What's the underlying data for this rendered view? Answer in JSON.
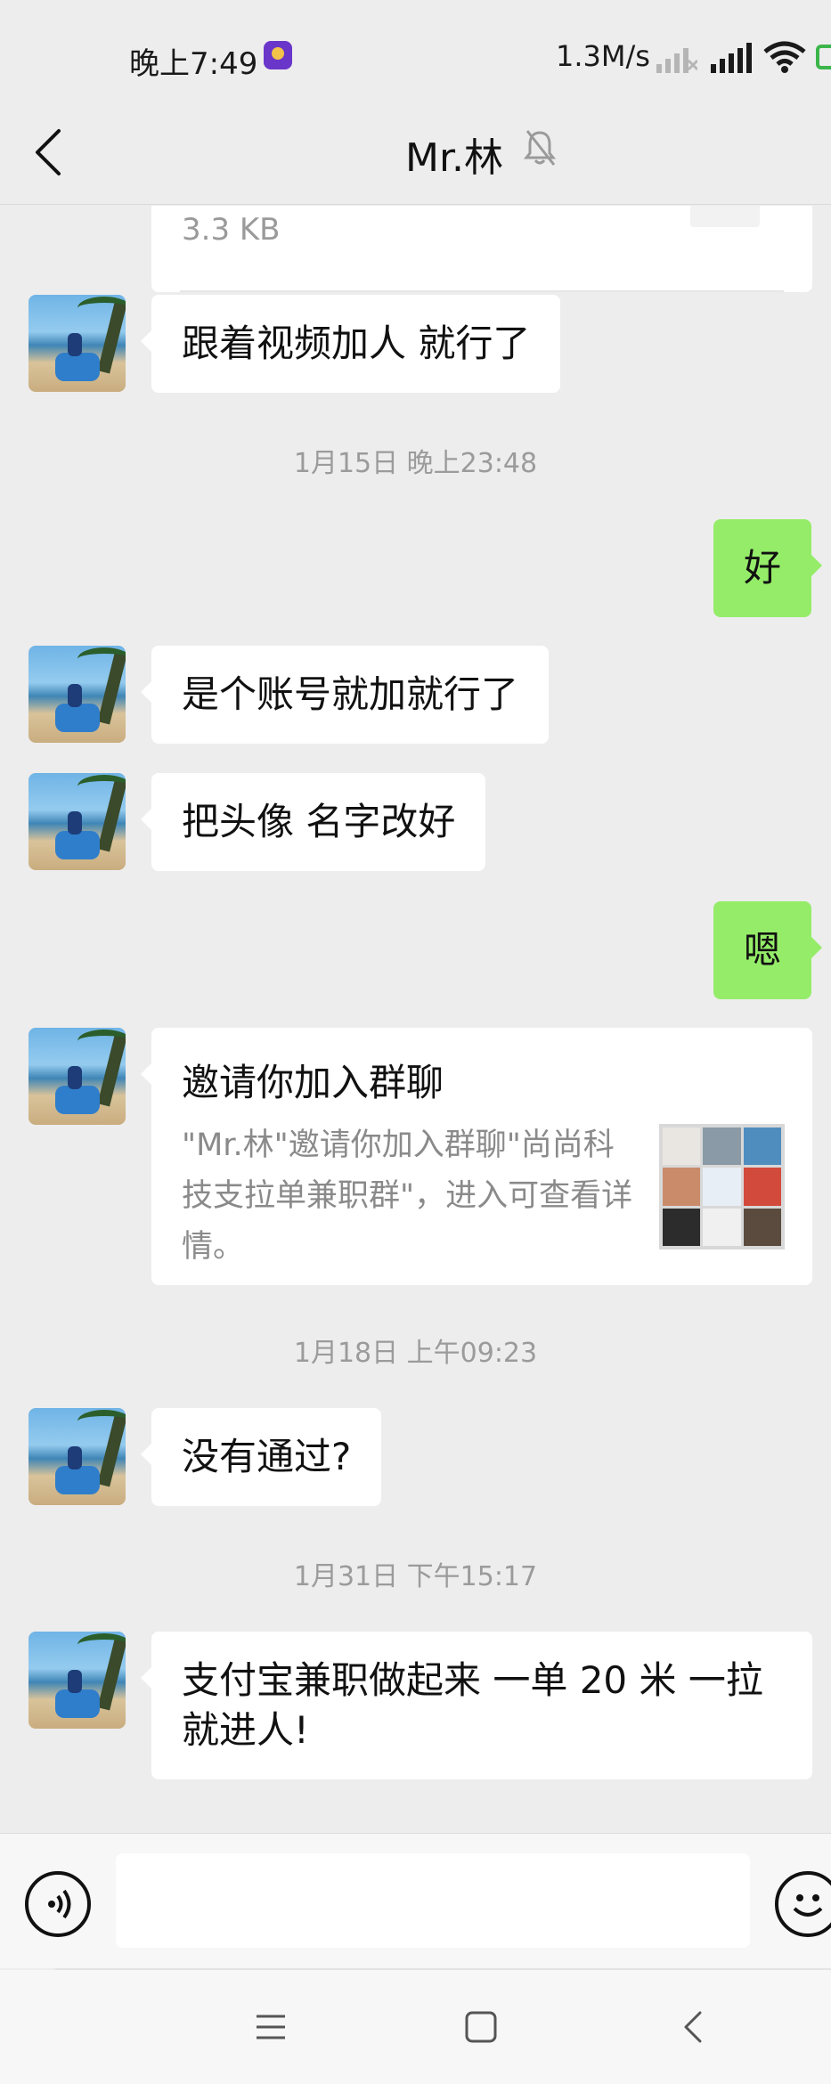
{
  "status_bar": {
    "time": "晚上7:49",
    "net_speed": "1.3M/s"
  },
  "nav": {
    "title": "Mr.林"
  },
  "file_card": {
    "size": "3.3 KB"
  },
  "messages": [
    {
      "side": "left",
      "text": "跟着视频加人 就行了"
    },
    {
      "timestamp": "1月15日 晚上23:48"
    },
    {
      "side": "right",
      "text": "好"
    },
    {
      "side": "left",
      "text": "是个账号就加就行了"
    },
    {
      "side": "left",
      "text": "把头像 名字改好"
    },
    {
      "side": "right",
      "text": "嗯"
    },
    {
      "side": "left",
      "type": "invite",
      "title": "邀请你加入群聊",
      "desc": "\"Mr.林\"邀请你加入群聊\"尚尚科技支拉单兼职群\"，进入可查看详情。"
    },
    {
      "timestamp": "1月18日 上午09:23"
    },
    {
      "side": "left",
      "text": "没有通过?"
    },
    {
      "timestamp": "1月31日 下午15:17"
    },
    {
      "side": "left",
      "text": "支付宝兼职做起来 一单 20 米 一拉就进人!"
    }
  ],
  "icons": {
    "back": "chevron-left-icon",
    "mute": "bell-off-icon",
    "voice": "voice-icon",
    "emoji": "emoji-icon",
    "menu": "menu-icon",
    "home": "square-icon",
    "sys_back": "chevron-left-icon"
  },
  "colors": {
    "background": "#ededed",
    "bubble_received": "#ffffff",
    "bubble_sent": "#95ec69"
  }
}
